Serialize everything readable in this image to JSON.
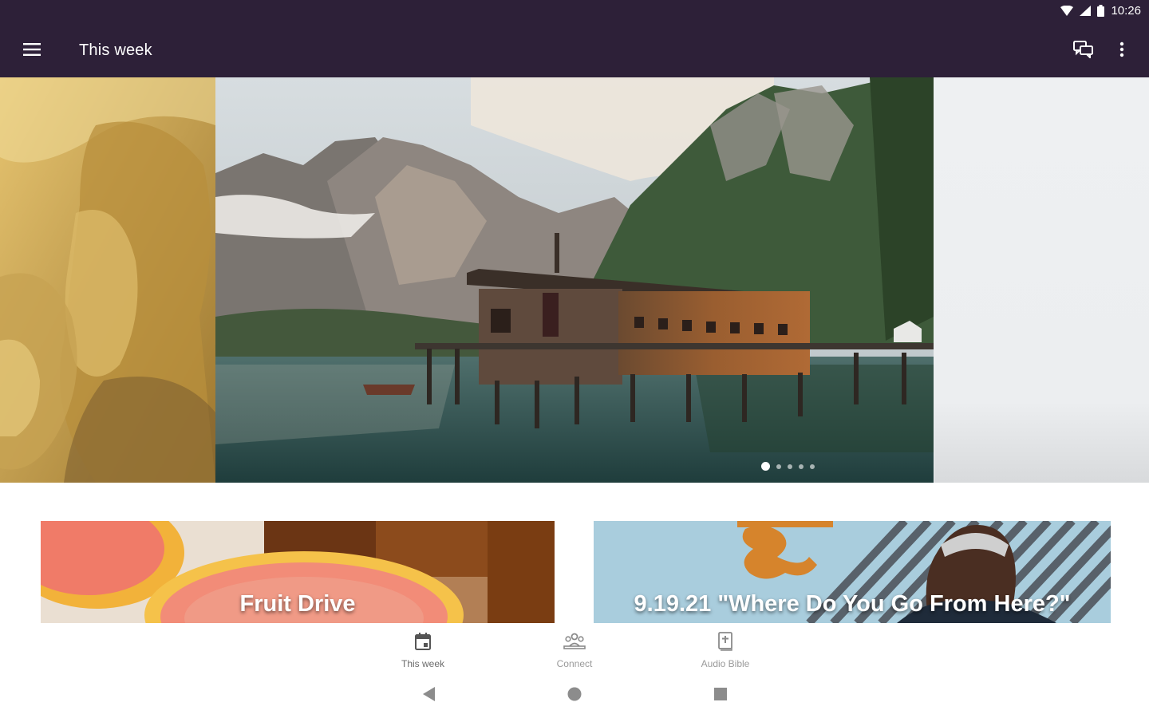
{
  "status_bar": {
    "time": "10:26"
  },
  "app_bar": {
    "title": "This week"
  },
  "carousel": {
    "slide_count": 5,
    "active_index": 0
  },
  "cards": [
    {
      "title": "Fruit Drive"
    },
    {
      "title": "9.19.21 \"Where Do You Go From Here?\""
    }
  ],
  "bottom_nav": {
    "items": [
      {
        "label": "This week",
        "icon": "calendar-icon",
        "active": true
      },
      {
        "label": "Connect",
        "icon": "people-icon",
        "active": false
      },
      {
        "label": "Audio Bible",
        "icon": "bible-icon",
        "active": false
      }
    ]
  },
  "colors": {
    "app_bar": "#2d2038",
    "nav_label": "#9a9a9a"
  }
}
